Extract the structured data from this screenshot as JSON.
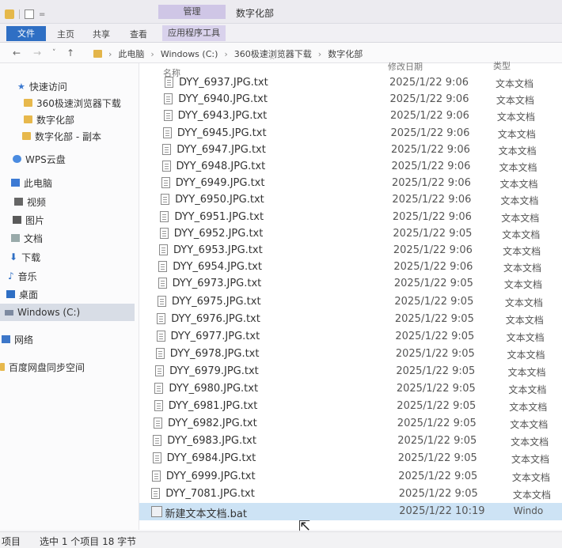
{
  "titlebar": {
    "context_tab": "管理",
    "title": "数字化部"
  },
  "ribbon": {
    "file_tab": "文件",
    "tabs": [
      "主页",
      "共享",
      "查看"
    ],
    "context_subtab": "应用程序工具"
  },
  "address": {
    "crumbs": [
      "此电脑",
      "Windows (C:)",
      "360极速浏览器下载",
      "数字化部"
    ]
  },
  "sidebar": {
    "items": [
      {
        "label": "快速访问",
        "icon": "star-icon"
      },
      {
        "label": "360极速浏览器下载",
        "icon": "folder-icon"
      },
      {
        "label": "数字化部",
        "icon": "folder-icon"
      },
      {
        "label": "数字化部 - 副本",
        "icon": "folder-icon"
      },
      {
        "label": "WPS云盘",
        "icon": "cloud-icon"
      },
      {
        "label": "此电脑",
        "icon": "computer-icon"
      },
      {
        "label": "视频",
        "icon": "video-icon"
      },
      {
        "label": "图片",
        "icon": "picture-icon"
      },
      {
        "label": "文档",
        "icon": "document-icon"
      },
      {
        "label": "下载",
        "icon": "download-icon"
      },
      {
        "label": "音乐",
        "icon": "music-icon"
      },
      {
        "label": "桌面",
        "icon": "desktop-icon"
      },
      {
        "label": "Windows (C:)",
        "icon": "drive-icon"
      },
      {
        "label": "网络",
        "icon": "network-icon"
      },
      {
        "label": "百度网盘同步空间",
        "icon": "cloud-folder-icon"
      }
    ]
  },
  "columns": {
    "name": "名称",
    "date": "修改日期",
    "type": "类型"
  },
  "files": [
    {
      "name": "DYY_6937.JPG.txt",
      "date": "2025/1/22 9:06",
      "type": "文本文档"
    },
    {
      "name": "DYY_6940.JPG.txt",
      "date": "2025/1/22 9:06",
      "type": "文本文档"
    },
    {
      "name": "DYY_6943.JPG.txt",
      "date": "2025/1/22 9:06",
      "type": "文本文档"
    },
    {
      "name": "DYY_6945.JPG.txt",
      "date": "2025/1/22 9:06",
      "type": "文本文档"
    },
    {
      "name": "DYY_6947.JPG.txt",
      "date": "2025/1/22 9:06",
      "type": "文本文档"
    },
    {
      "name": "DYY_6948.JPG.txt",
      "date": "2025/1/22 9:06",
      "type": "文本文档"
    },
    {
      "name": "DYY_6949.JPG.txt",
      "date": "2025/1/22 9:06",
      "type": "文本文档"
    },
    {
      "name": "DYY_6950.JPG.txt",
      "date": "2025/1/22 9:06",
      "type": "文本文档"
    },
    {
      "name": "DYY_6951.JPG.txt",
      "date": "2025/1/22 9:06",
      "type": "文本文档"
    },
    {
      "name": "DYY_6952.JPG.txt",
      "date": "2025/1/22 9:05",
      "type": "文本文档"
    },
    {
      "name": "DYY_6953.JPG.txt",
      "date": "2025/1/22 9:06",
      "type": "文本文档"
    },
    {
      "name": "DYY_6954.JPG.txt",
      "date": "2025/1/22 9:06",
      "type": "文本文档"
    },
    {
      "name": "DYY_6973.JPG.txt",
      "date": "2025/1/22 9:05",
      "type": "文本文档"
    },
    {
      "name": "DYY_6975.JPG.txt",
      "date": "2025/1/22 9:05",
      "type": "文本文档"
    },
    {
      "name": "DYY_6976.JPG.txt",
      "date": "2025/1/22 9:05",
      "type": "文本文档"
    },
    {
      "name": "DYY_6977.JPG.txt",
      "date": "2025/1/22 9:05",
      "type": "文本文档"
    },
    {
      "name": "DYY_6978.JPG.txt",
      "date": "2025/1/22 9:05",
      "type": "文本文档"
    },
    {
      "name": "DYY_6979.JPG.txt",
      "date": "2025/1/22 9:05",
      "type": "文本文档"
    },
    {
      "name": "DYY_6980.JPG.txt",
      "date": "2025/1/22 9:05",
      "type": "文本文档"
    },
    {
      "name": "DYY_6981.JPG.txt",
      "date": "2025/1/22 9:05",
      "type": "文本文档"
    },
    {
      "name": "DYY_6982.JPG.txt",
      "date": "2025/1/22 9:05",
      "type": "文本文档"
    },
    {
      "name": "DYY_6983.JPG.txt",
      "date": "2025/1/22 9:05",
      "type": "文本文档"
    },
    {
      "name": "DYY_6984.JPG.txt",
      "date": "2025/1/22 9:05",
      "type": "文本文档"
    },
    {
      "name": "DYY_6999.JPG.txt",
      "date": "2025/1/22 9:05",
      "type": "文本文档"
    },
    {
      "name": "DYY_7081.JPG.txt",
      "date": "2025/1/22 9:05",
      "type": "文本文档"
    },
    {
      "name": "新建文本文档.bat",
      "date": "2025/1/22 10:19",
      "type": "Windo"
    }
  ],
  "status": {
    "items": "项目",
    "selection": "选中 1 个项目  18 字节"
  }
}
